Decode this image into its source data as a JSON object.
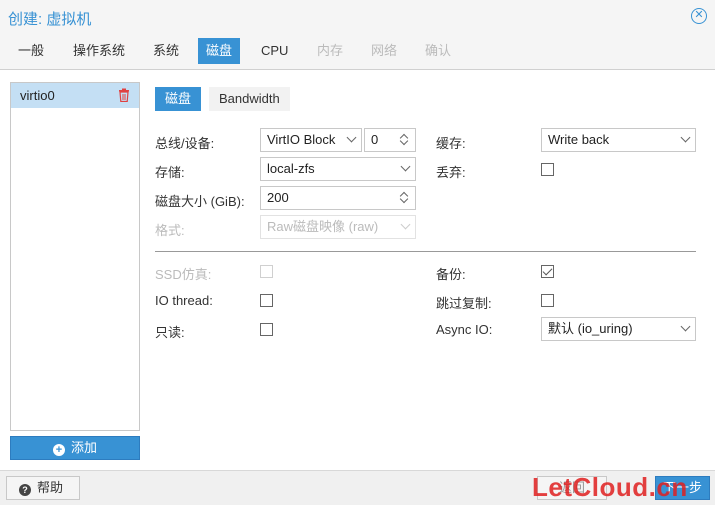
{
  "window": {
    "title": "创建: 虚拟机"
  },
  "tabs": [
    {
      "label": "一般",
      "state": "normal"
    },
    {
      "label": "操作系统",
      "state": "normal"
    },
    {
      "label": "系统",
      "state": "normal"
    },
    {
      "label": "磁盘",
      "state": "active"
    },
    {
      "label": "CPU",
      "state": "normal"
    },
    {
      "label": "内存",
      "state": "disabled"
    },
    {
      "label": "网络",
      "state": "disabled"
    },
    {
      "label": "确认",
      "state": "disabled"
    }
  ],
  "disk_list": {
    "items": [
      {
        "label": "virtio0"
      }
    ],
    "add_label": "添加"
  },
  "subtabs": {
    "disk": "磁盘",
    "bandwidth": "Bandwidth"
  },
  "form": {
    "bus_device": {
      "label": "总线/设备:",
      "bus": "VirtIO Block",
      "index": "0"
    },
    "storage": {
      "label": "存储:",
      "value": "local-zfs"
    },
    "disk_size": {
      "label": "磁盘大小 (GiB):",
      "value": "200"
    },
    "format": {
      "label": "格式:",
      "value": "Raw磁盘映像 (raw)"
    },
    "cache": {
      "label": "缓存:",
      "value": "Write back"
    },
    "discard": {
      "label": "丢弃:",
      "checked": false
    },
    "ssd": {
      "label": "SSD仿真:",
      "checked": false
    },
    "io_thread": {
      "label": "IO thread:",
      "checked": false
    },
    "read_only": {
      "label": "只读:",
      "checked": false
    },
    "backup": {
      "label": "备份:",
      "checked": true
    },
    "skip_replication": {
      "label": "跳过复制:",
      "checked": false
    },
    "async_io": {
      "label": "Async IO:",
      "value": "默认 (io_uring)"
    }
  },
  "footer": {
    "help": "帮助",
    "back": "返回",
    "next": "下一步",
    "watermark": "LetCloud.cn"
  },
  "colors": {
    "accent": "#3892d4",
    "selected_row": "#c4dff4",
    "delete_icon": "#e04040"
  }
}
